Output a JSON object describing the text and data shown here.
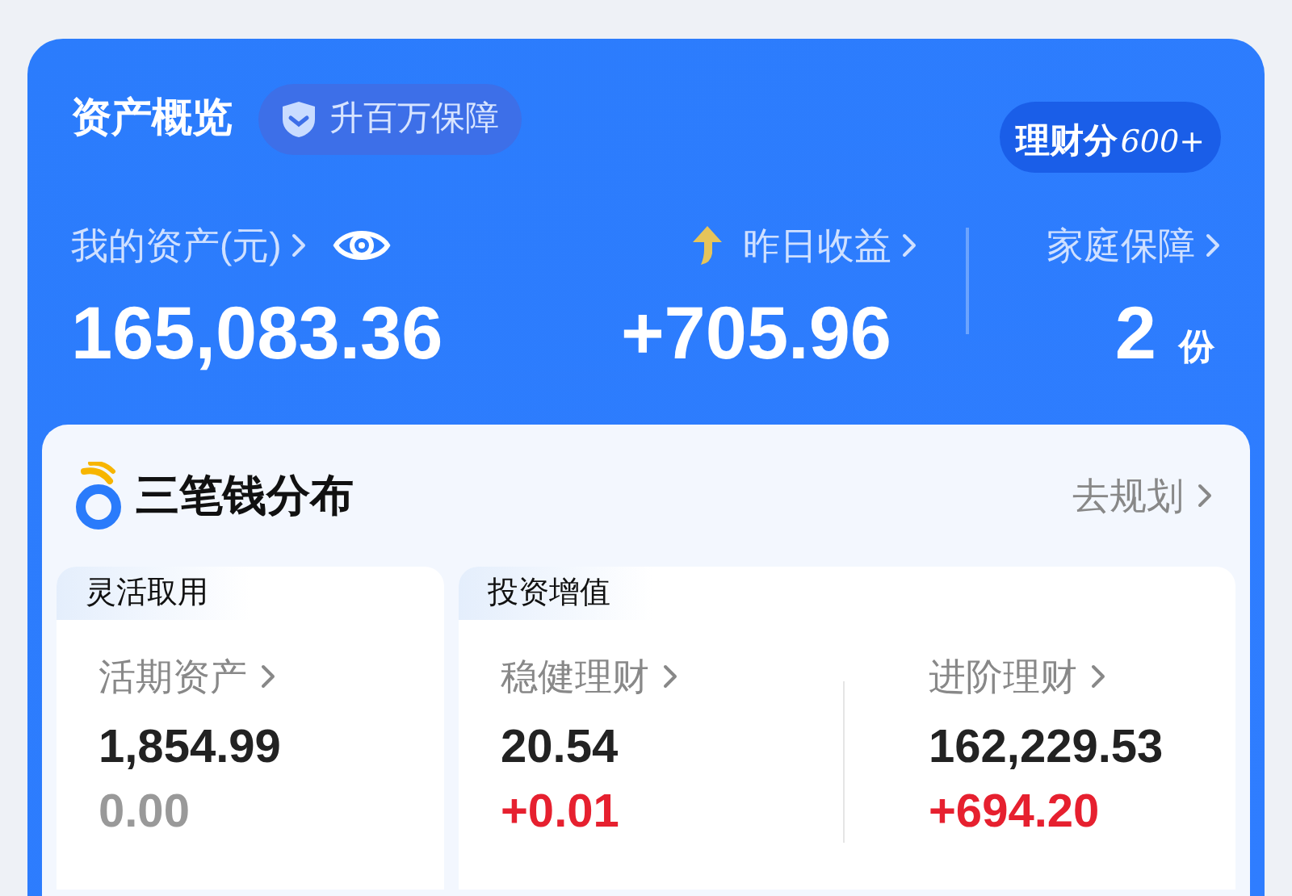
{
  "overview": {
    "title": "资产概览",
    "badge": "升百万保障",
    "score": {
      "label": "理财分",
      "value": "600+"
    }
  },
  "stats": [
    {
      "kind": "assets",
      "label": "我的资产(元)",
      "value": "165,083.36"
    },
    {
      "kind": "earnings",
      "label": "昨日收益",
      "value": "+705.96"
    },
    {
      "kind": "protection",
      "label": "家庭保障",
      "value": "2",
      "unit": "份"
    }
  ],
  "distribution": {
    "title": "三笔钱分布",
    "link": "去规划",
    "groups": [
      {
        "tag": "灵活取用",
        "items": [
          {
            "label": "活期资产",
            "value": "1,854.99",
            "change": "0.00",
            "color": "#999999"
          }
        ]
      },
      {
        "tag": "投资增值",
        "items": [
          {
            "label": "稳健理财",
            "value": "20.54",
            "change": "+0.01",
            "color": "#e6202f"
          },
          {
            "label": "进阶理财",
            "value": "162,229.53",
            "change": "+694.20",
            "color": "#e6202f"
          }
        ]
      }
    ]
  }
}
